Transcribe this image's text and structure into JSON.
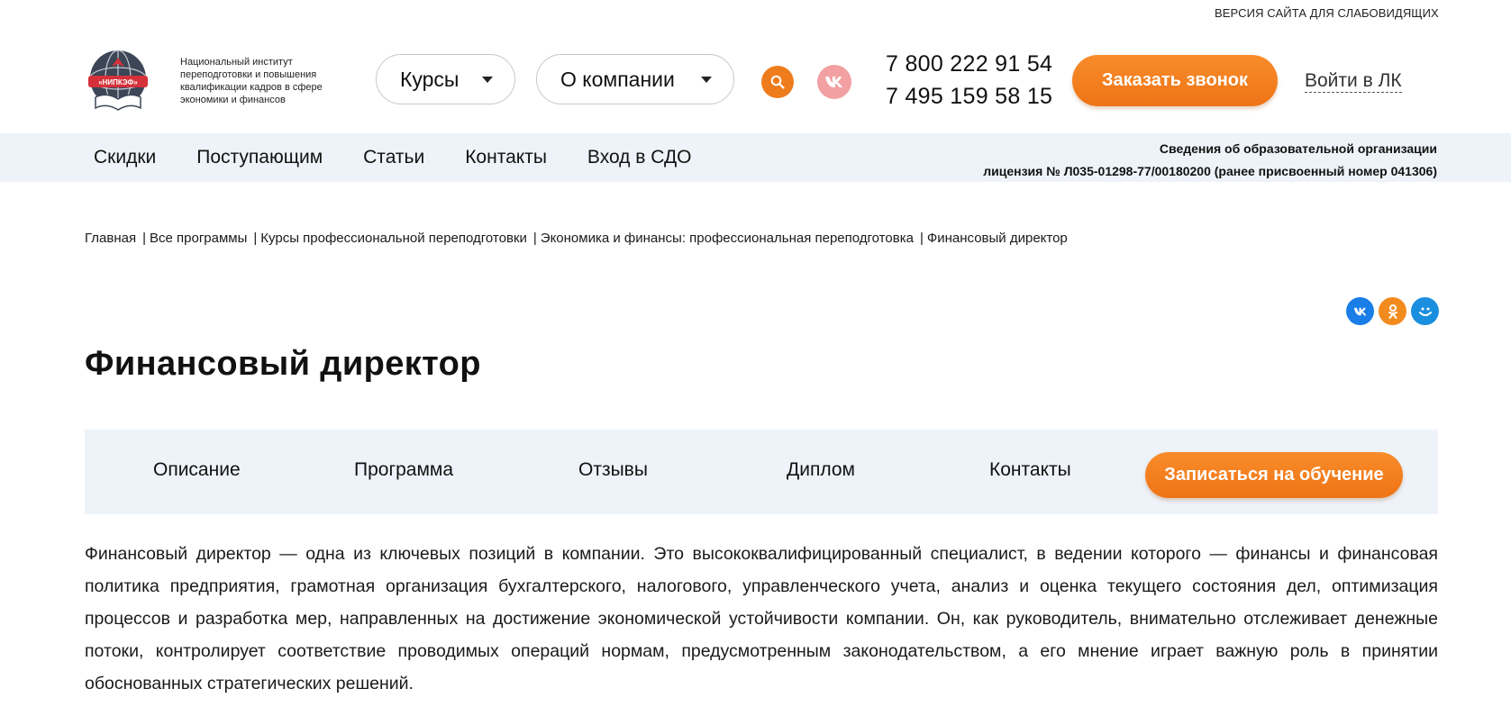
{
  "header": {
    "vision_version": "ВЕРСИЯ САЙТА ДЛЯ СЛАБОВИДЯЩИХ",
    "logo_text": "Национальный институт переподготовки и повышения квалификации кадров в сфере экономики и финансов",
    "logo_badge": "«НИПКЭФ»",
    "menu_courses": "Курсы",
    "menu_company": "О компании",
    "phone_1": "7 800 222 91 54",
    "phone_2": "7 495 159 58 15",
    "callback_button": "Заказать звонок",
    "login_link": "Войти в ЛК",
    "vk_icon": "vk-icon",
    "search_icon": "search-icon"
  },
  "navbar": {
    "items": [
      "Скидки",
      "Поступающим",
      "Статьи",
      "Контакты",
      "Вход в СДО"
    ],
    "org_info": "Сведения об образовательной организации",
    "license": "лицензия № Л035-01298-77/00180200 (ранее присвоенный номер 041306)"
  },
  "breadcrumb": [
    "Главная",
    "Все программы",
    "Курсы профессиональной переподготовки",
    "Экономика и финансы: профессиональная переподготовка",
    "Финансовый директор"
  ],
  "share": {
    "vk": "ВК",
    "ok": "ОК",
    "mm": "☺"
  },
  "page_title": "Финансовый директор",
  "tabs": {
    "items": [
      "Описание",
      "Программа",
      "Отзывы",
      "Диплом",
      "Контакты"
    ],
    "enroll_button": "Записаться на обучение"
  },
  "description": "Финансовый директор — одна из ключевых позиций в компании. Это высококвалифицированный специалист, в ведении которого — финансы и финансовая политика предприятия, грамотная организация бухгалтерского, налогового, управленческого учета, анализ и оценка текущего состояния дел, оптимизация процессов и разработка мер, направленных на достижение экономической устойчивости компании. Он, как руководитель, внимательно отслеживает денежные потоки, контролирует соответствие проводимых операций нормам, предусмотренным законодательством, а его мнение играет важную роль в принятии обоснованных стратегических решений.",
  "colors": {
    "accent": "#ef7c1c",
    "nav_bg": "#eef3f9",
    "vk_share": "#1a7ee8",
    "ok_share": "#f28b1e"
  }
}
